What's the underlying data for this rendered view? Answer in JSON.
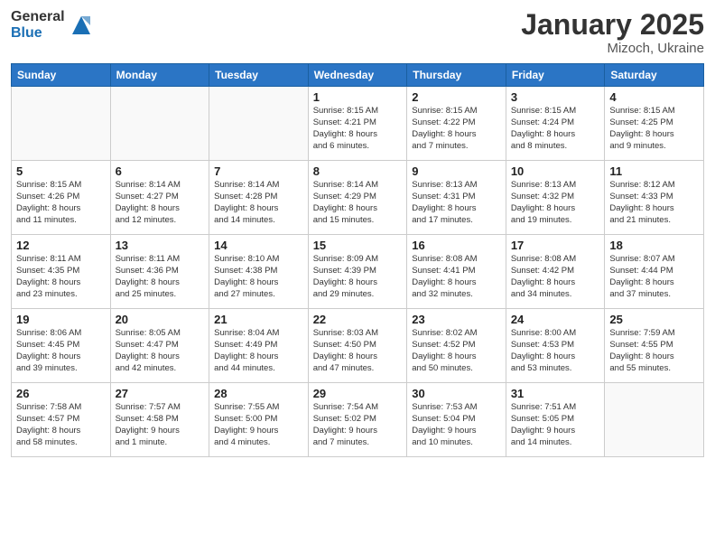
{
  "header": {
    "logo_general": "General",
    "logo_blue": "Blue",
    "month_title": "January 2025",
    "location": "Mizoch, Ukraine"
  },
  "weekdays": [
    "Sunday",
    "Monday",
    "Tuesday",
    "Wednesday",
    "Thursday",
    "Friday",
    "Saturday"
  ],
  "weeks": [
    [
      {
        "day": "",
        "info": ""
      },
      {
        "day": "",
        "info": ""
      },
      {
        "day": "",
        "info": ""
      },
      {
        "day": "1",
        "info": "Sunrise: 8:15 AM\nSunset: 4:21 PM\nDaylight: 8 hours\nand 6 minutes."
      },
      {
        "day": "2",
        "info": "Sunrise: 8:15 AM\nSunset: 4:22 PM\nDaylight: 8 hours\nand 7 minutes."
      },
      {
        "day": "3",
        "info": "Sunrise: 8:15 AM\nSunset: 4:24 PM\nDaylight: 8 hours\nand 8 minutes."
      },
      {
        "day": "4",
        "info": "Sunrise: 8:15 AM\nSunset: 4:25 PM\nDaylight: 8 hours\nand 9 minutes."
      }
    ],
    [
      {
        "day": "5",
        "info": "Sunrise: 8:15 AM\nSunset: 4:26 PM\nDaylight: 8 hours\nand 11 minutes."
      },
      {
        "day": "6",
        "info": "Sunrise: 8:14 AM\nSunset: 4:27 PM\nDaylight: 8 hours\nand 12 minutes."
      },
      {
        "day": "7",
        "info": "Sunrise: 8:14 AM\nSunset: 4:28 PM\nDaylight: 8 hours\nand 14 minutes."
      },
      {
        "day": "8",
        "info": "Sunrise: 8:14 AM\nSunset: 4:29 PM\nDaylight: 8 hours\nand 15 minutes."
      },
      {
        "day": "9",
        "info": "Sunrise: 8:13 AM\nSunset: 4:31 PM\nDaylight: 8 hours\nand 17 minutes."
      },
      {
        "day": "10",
        "info": "Sunrise: 8:13 AM\nSunset: 4:32 PM\nDaylight: 8 hours\nand 19 minutes."
      },
      {
        "day": "11",
        "info": "Sunrise: 8:12 AM\nSunset: 4:33 PM\nDaylight: 8 hours\nand 21 minutes."
      }
    ],
    [
      {
        "day": "12",
        "info": "Sunrise: 8:11 AM\nSunset: 4:35 PM\nDaylight: 8 hours\nand 23 minutes."
      },
      {
        "day": "13",
        "info": "Sunrise: 8:11 AM\nSunset: 4:36 PM\nDaylight: 8 hours\nand 25 minutes."
      },
      {
        "day": "14",
        "info": "Sunrise: 8:10 AM\nSunset: 4:38 PM\nDaylight: 8 hours\nand 27 minutes."
      },
      {
        "day": "15",
        "info": "Sunrise: 8:09 AM\nSunset: 4:39 PM\nDaylight: 8 hours\nand 29 minutes."
      },
      {
        "day": "16",
        "info": "Sunrise: 8:08 AM\nSunset: 4:41 PM\nDaylight: 8 hours\nand 32 minutes."
      },
      {
        "day": "17",
        "info": "Sunrise: 8:08 AM\nSunset: 4:42 PM\nDaylight: 8 hours\nand 34 minutes."
      },
      {
        "day": "18",
        "info": "Sunrise: 8:07 AM\nSunset: 4:44 PM\nDaylight: 8 hours\nand 37 minutes."
      }
    ],
    [
      {
        "day": "19",
        "info": "Sunrise: 8:06 AM\nSunset: 4:45 PM\nDaylight: 8 hours\nand 39 minutes."
      },
      {
        "day": "20",
        "info": "Sunrise: 8:05 AM\nSunset: 4:47 PM\nDaylight: 8 hours\nand 42 minutes."
      },
      {
        "day": "21",
        "info": "Sunrise: 8:04 AM\nSunset: 4:49 PM\nDaylight: 8 hours\nand 44 minutes."
      },
      {
        "day": "22",
        "info": "Sunrise: 8:03 AM\nSunset: 4:50 PM\nDaylight: 8 hours\nand 47 minutes."
      },
      {
        "day": "23",
        "info": "Sunrise: 8:02 AM\nSunset: 4:52 PM\nDaylight: 8 hours\nand 50 minutes."
      },
      {
        "day": "24",
        "info": "Sunrise: 8:00 AM\nSunset: 4:53 PM\nDaylight: 8 hours\nand 53 minutes."
      },
      {
        "day": "25",
        "info": "Sunrise: 7:59 AM\nSunset: 4:55 PM\nDaylight: 8 hours\nand 55 minutes."
      }
    ],
    [
      {
        "day": "26",
        "info": "Sunrise: 7:58 AM\nSunset: 4:57 PM\nDaylight: 8 hours\nand 58 minutes."
      },
      {
        "day": "27",
        "info": "Sunrise: 7:57 AM\nSunset: 4:58 PM\nDaylight: 9 hours\nand 1 minute."
      },
      {
        "day": "28",
        "info": "Sunrise: 7:55 AM\nSunset: 5:00 PM\nDaylight: 9 hours\nand 4 minutes."
      },
      {
        "day": "29",
        "info": "Sunrise: 7:54 AM\nSunset: 5:02 PM\nDaylight: 9 hours\nand 7 minutes."
      },
      {
        "day": "30",
        "info": "Sunrise: 7:53 AM\nSunset: 5:04 PM\nDaylight: 9 hours\nand 10 minutes."
      },
      {
        "day": "31",
        "info": "Sunrise: 7:51 AM\nSunset: 5:05 PM\nDaylight: 9 hours\nand 14 minutes."
      },
      {
        "day": "",
        "info": ""
      }
    ]
  ]
}
